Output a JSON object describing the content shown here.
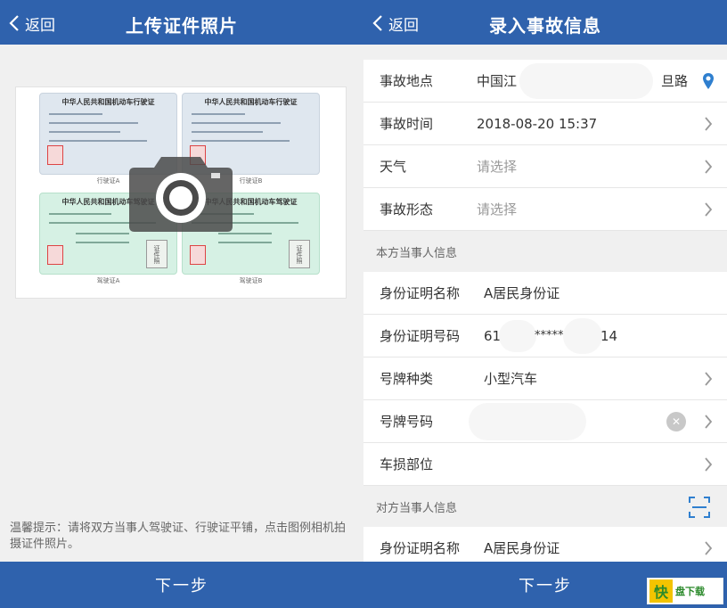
{
  "left": {
    "header": {
      "back_label": "返回",
      "title": "上传证件照片"
    },
    "licenses": [
      {
        "title": "中华人民共和国机动车行驶证",
        "caption": "行驶证A"
      },
      {
        "title": "中华人民共和国机动车行驶证",
        "caption": "行驶证B"
      },
      {
        "title": "中华人民共和国机动车驾驶证",
        "caption": "驾驶证A",
        "photo_label": "证件照"
      },
      {
        "title": "中华人民共和国机动车驾驶证",
        "caption": "驾驶证B",
        "photo_label": "证件照"
      }
    ],
    "tip": "温馨提示：请将双方当事人驾驶证、行驶证平铺，点击图例相机拍摄证件照片。",
    "footer": {
      "next_label": "下一步"
    }
  },
  "right": {
    "header": {
      "back_label": "返回",
      "title": "录入事故信息"
    },
    "accident": [
      {
        "label": "事故地点",
        "value": "中国江",
        "value_tail": "旦路"
      },
      {
        "label": "事故时间",
        "value": "2018-08-20 15:37"
      },
      {
        "label": "天气",
        "value": "请选择"
      },
      {
        "label": "事故形态",
        "value": "请选择"
      }
    ],
    "own_section": "本方当事人信息",
    "own": [
      {
        "label": "身份证明名称",
        "value": "A居民身份证"
      },
      {
        "label": "身份证明号码",
        "value": "61",
        "value_mid": "*****",
        "value_tail": "14"
      },
      {
        "label": "号牌种类",
        "value": "小型汽车"
      },
      {
        "label": "号牌号码",
        "value": ""
      },
      {
        "label": "车损部位",
        "value": ""
      }
    ],
    "other_section": "对方当事人信息",
    "other": [
      {
        "label": "身份证明名称",
        "value": "A居民身份证"
      }
    ],
    "footer": {
      "next_label": "下一步"
    }
  },
  "logo": {
    "mark": "快",
    "text": "盘下载"
  },
  "colors": {
    "primary": "#2f62ad",
    "accent_icon": "#2f7fcf"
  }
}
